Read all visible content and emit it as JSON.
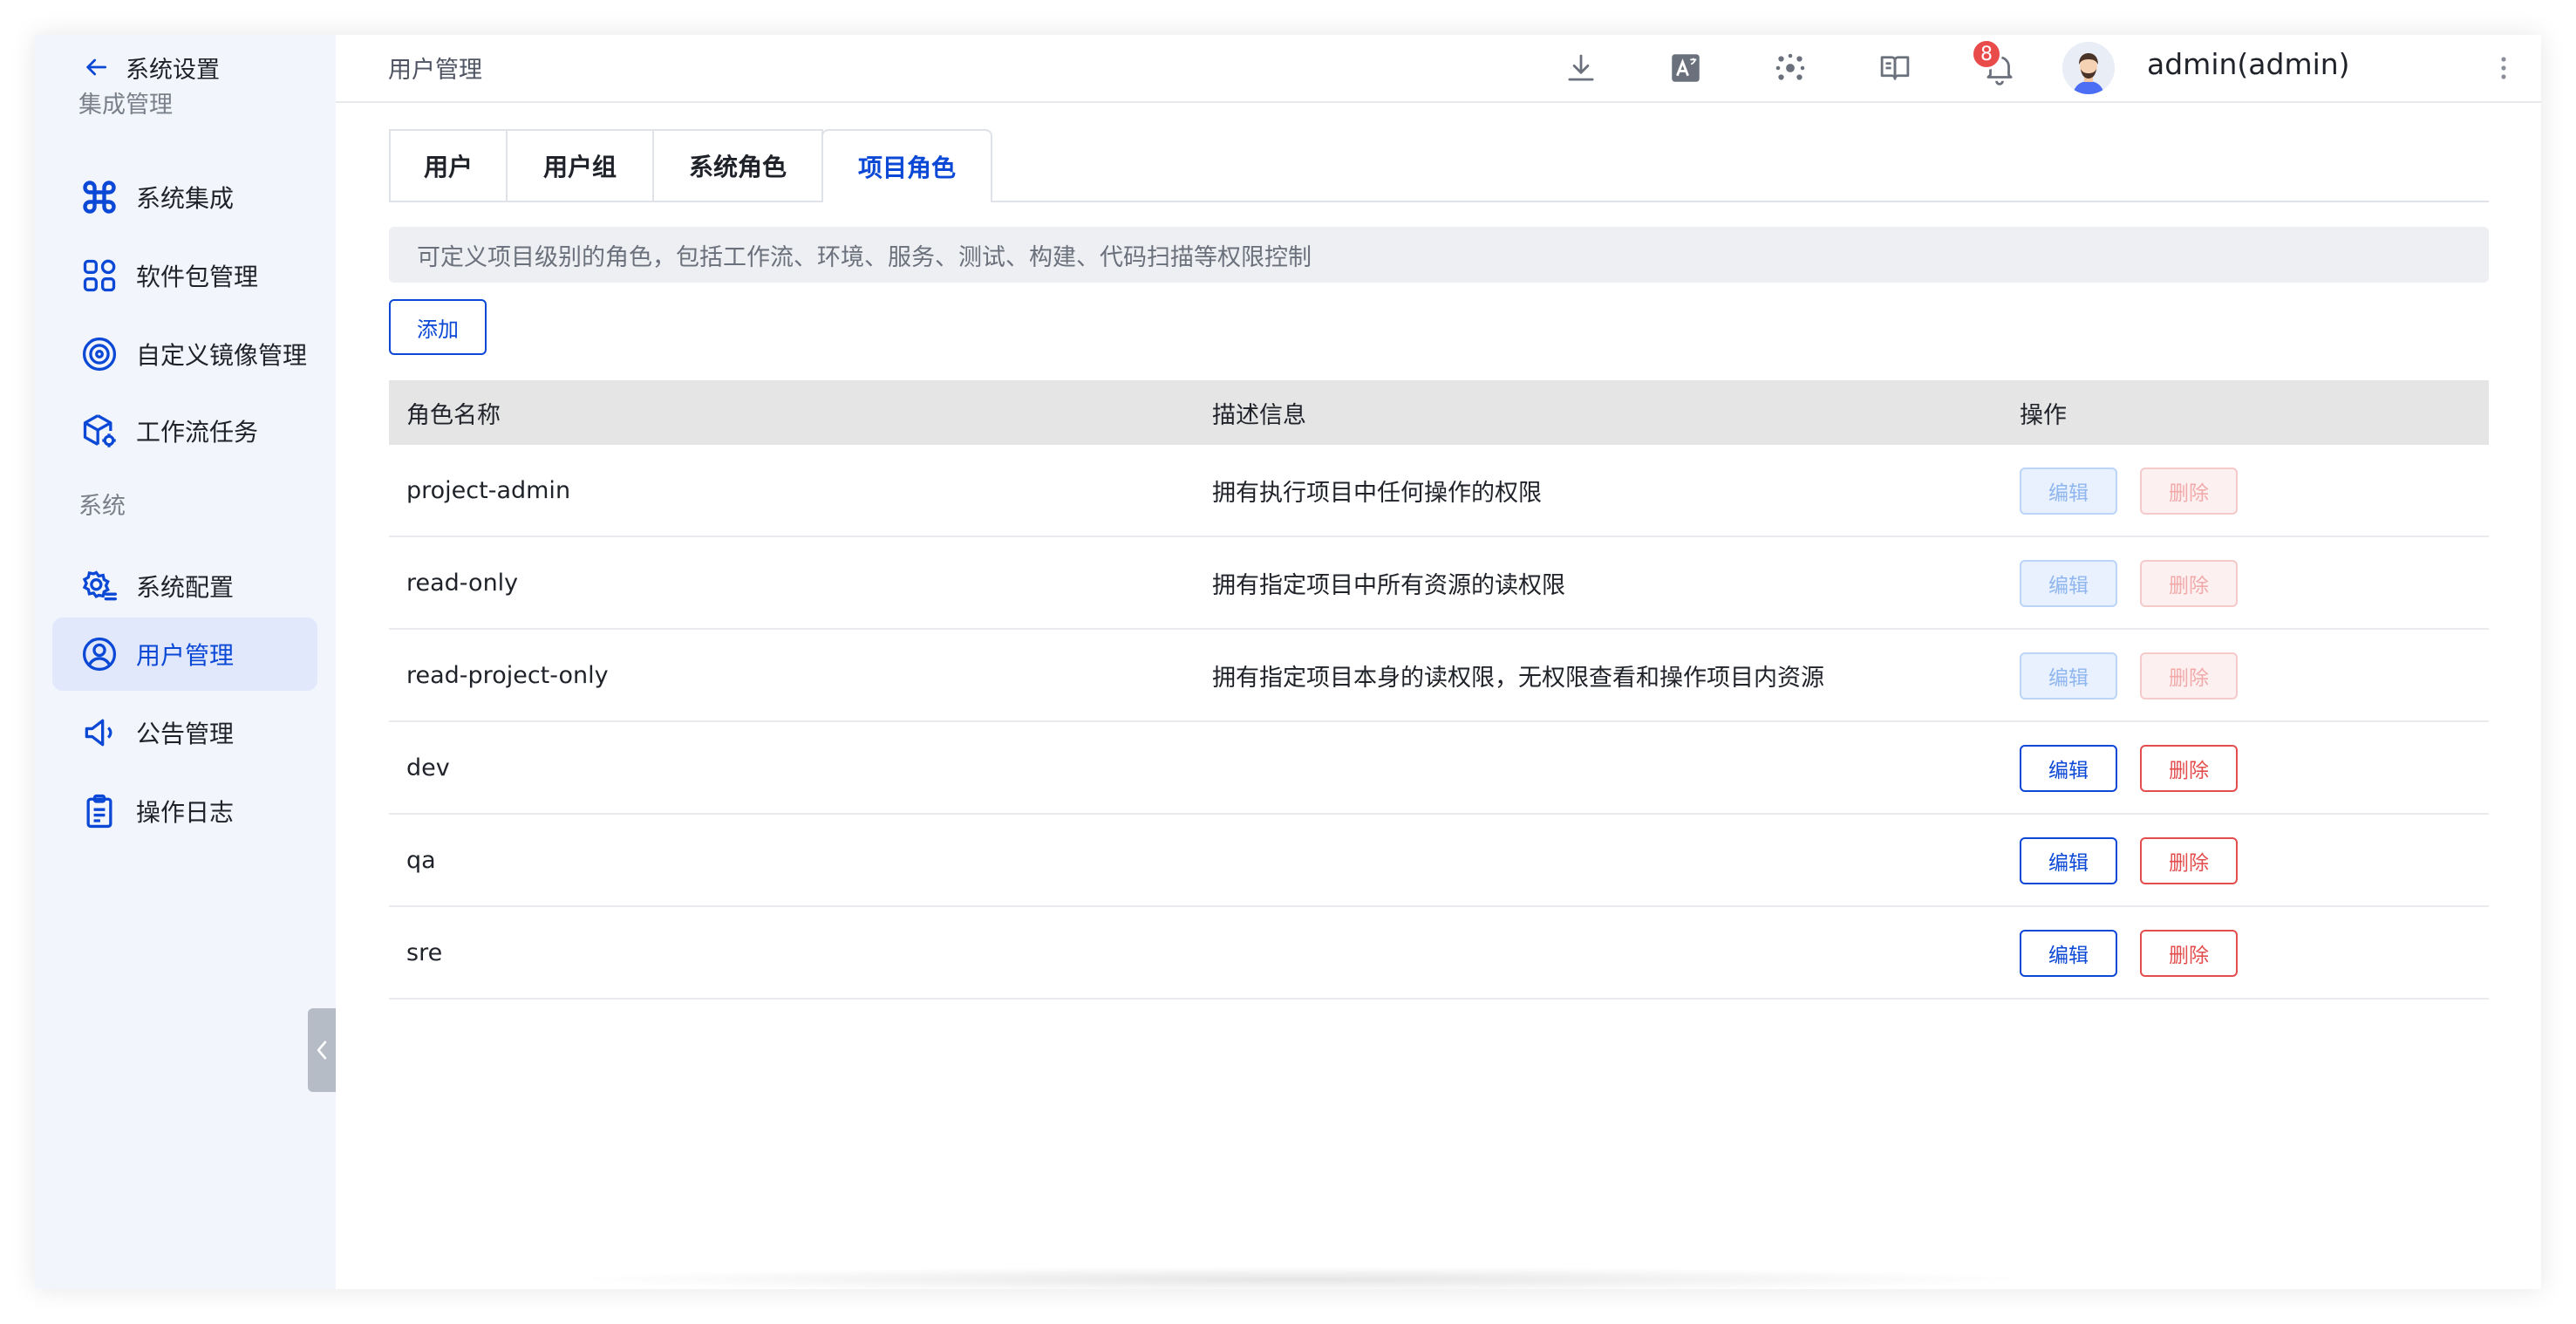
{
  "sidebar": {
    "back_label": "系统设置",
    "group_integration": "集成管理",
    "group_system": "系统",
    "items": [
      {
        "label": "系统集成",
        "icon": "command-icon"
      },
      {
        "label": "软件包管理",
        "icon": "apps-icon"
      },
      {
        "label": "自定义镜像管理",
        "icon": "disc-icon"
      },
      {
        "label": "工作流任务",
        "icon": "cube-gear-icon"
      },
      {
        "label": "系统配置",
        "icon": "gear-list-icon"
      },
      {
        "label": "用户管理",
        "icon": "user-circle-icon",
        "active": true
      },
      {
        "label": "公告管理",
        "icon": "megaphone-icon"
      },
      {
        "label": "操作日志",
        "icon": "clipboard-icon"
      }
    ]
  },
  "header": {
    "title": "用户管理",
    "icons": [
      "download-icon",
      "translate-icon",
      "plugin-icon",
      "book-icon",
      "bell-icon"
    ],
    "notification_count": "8",
    "user_name": "admin(admin)"
  },
  "tabs": [
    {
      "label": "用户"
    },
    {
      "label": "用户组"
    },
    {
      "label": "系统角色"
    },
    {
      "label": "项目角色",
      "active": true
    }
  ],
  "description": "可定义项目级别的角色，包括工作流、环境、服务、测试、构建、代码扫描等权限控制",
  "add_label": "添加",
  "table": {
    "columns": [
      "角色名称",
      "描述信息",
      "操作"
    ],
    "edit_label": "编辑",
    "delete_label": "删除",
    "rows": [
      {
        "name": "project-admin",
        "desc": "拥有执行项目中任何操作的权限",
        "disabled": true
      },
      {
        "name": "read-only",
        "desc": "拥有指定项目中所有资源的读权限",
        "disabled": true
      },
      {
        "name": "read-project-only",
        "desc": "拥有指定项目本身的读权限，无权限查看和操作项目内资源",
        "disabled": true
      },
      {
        "name": "dev",
        "desc": "",
        "disabled": false
      },
      {
        "name": "qa",
        "desc": "",
        "disabled": false
      },
      {
        "name": "sre",
        "desc": "",
        "disabled": false
      }
    ]
  },
  "colors": {
    "primary": "#0b48d6",
    "danger": "#e34d4d",
    "sidebar_bg": "#f2f5fc",
    "active_bg": "#e1e8fb",
    "badge": "#e94b4b"
  }
}
